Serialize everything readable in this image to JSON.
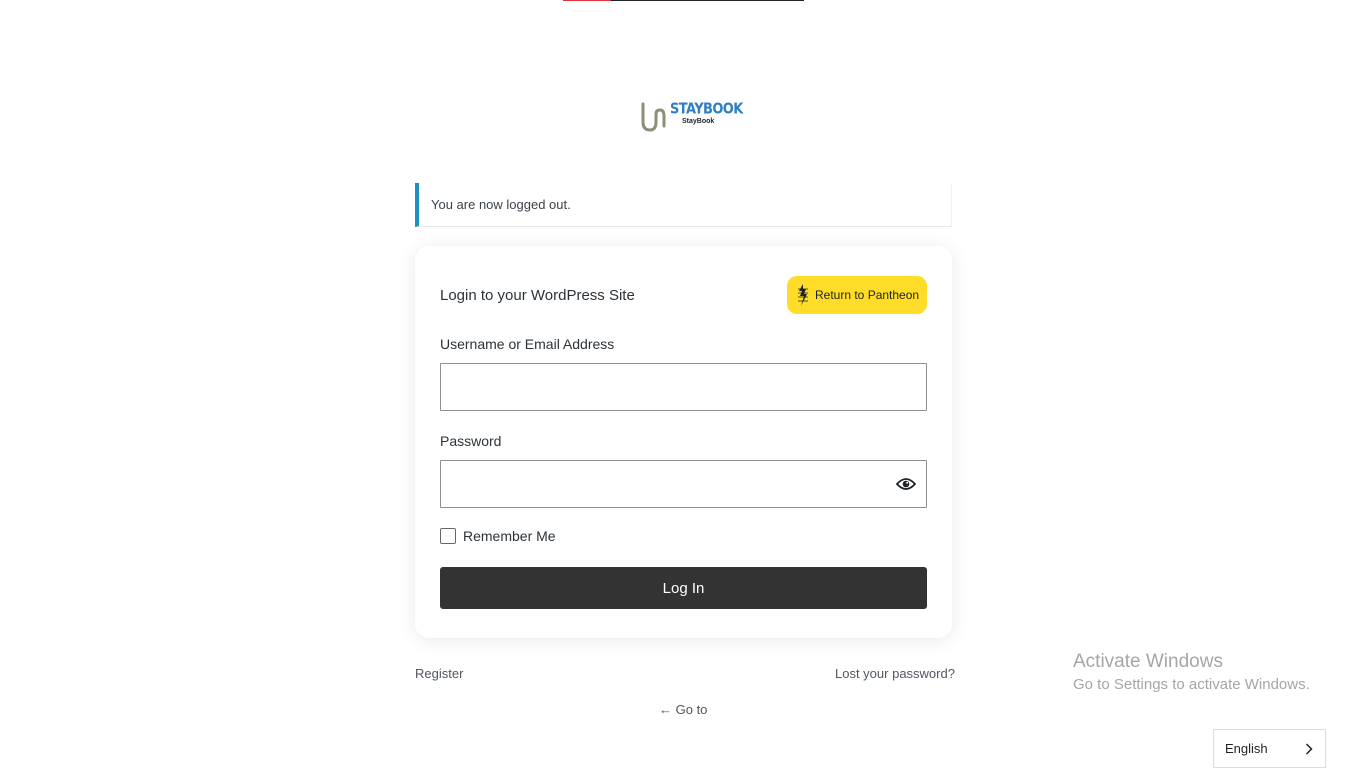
{
  "logo": {
    "brand": "STAYBOOK",
    "sub": "StayBook"
  },
  "notice": {
    "message": "You are now logged out."
  },
  "login_form": {
    "title": "Login to your WordPress Site",
    "pantheon_button": "Return to Pantheon",
    "username_label": "Username or Email Address",
    "username_value": "",
    "password_label": "Password",
    "password_value": "",
    "remember_label": "Remember Me",
    "remember_checked": false,
    "submit_label": "Log In"
  },
  "footer_links": {
    "register": "Register",
    "lost_password": "Lost your password?",
    "go_to": "← Go to"
  },
  "windows_watermark": {
    "title": "Activate Windows",
    "subtitle": "Go to Settings to activate Windows."
  },
  "language_switcher": {
    "selected": "English"
  },
  "colors": {
    "accent_notice": "#1f8fc4",
    "pantheon_yellow": "#ffdc28",
    "login_button": "#333333",
    "brand_blue": "#2e7fc4"
  },
  "icons": {
    "pantheon": "pantheon-icon",
    "password_toggle": "eye-icon",
    "language_chevron": "chevron-right-icon"
  }
}
